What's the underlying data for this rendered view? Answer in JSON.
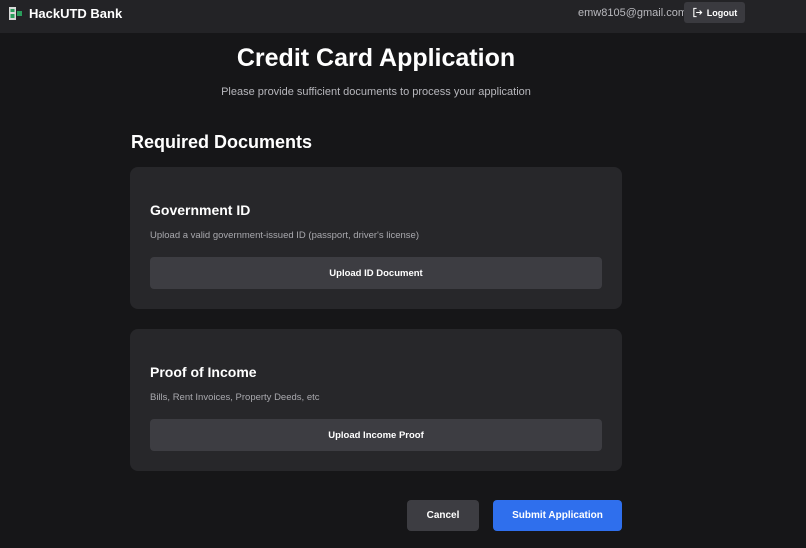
{
  "navbar": {
    "brand_name": "HackUTD Bank",
    "brand_icon": "bank-logo-icon",
    "user_email": "emw8105@gmail.com",
    "logout_label": "Logout",
    "logout_icon": "logout-icon"
  },
  "header": {
    "title": "Credit Card Application",
    "subtitle": "Please provide sufficient documents to process your application"
  },
  "documents": {
    "section_title": "Required Documents",
    "items": [
      {
        "title": "Government ID",
        "description": "Upload a valid government-issued ID (passport, driver's license)",
        "button_label": "Upload ID Document"
      },
      {
        "title": "Proof of Income",
        "description": "Bills, Rent Invoices, Property Deeds, etc",
        "button_label": "Upload Income Proof"
      }
    ]
  },
  "actions": {
    "cancel_label": "Cancel",
    "submit_label": "Submit Application"
  },
  "colors": {
    "background": "#161618",
    "navbar": "#232326",
    "card": "#27272a",
    "button": "#3d3d42",
    "primary": "#2f6fed"
  }
}
